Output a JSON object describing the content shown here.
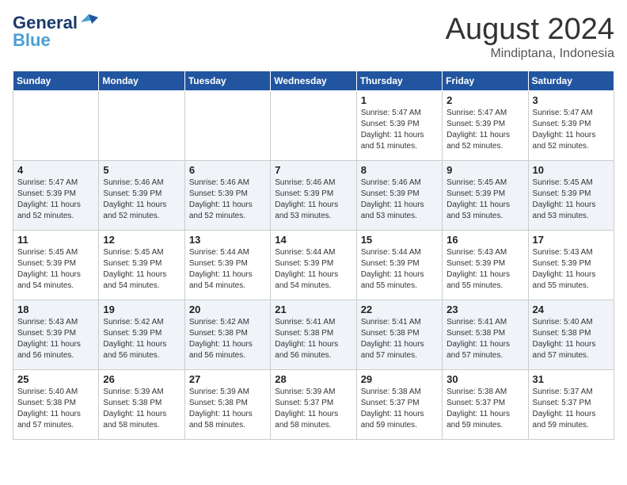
{
  "header": {
    "logo_line1": "General",
    "logo_line2": "Blue",
    "month_year": "August 2024",
    "location": "Mindiptana, Indonesia"
  },
  "days_of_week": [
    "Sunday",
    "Monday",
    "Tuesday",
    "Wednesday",
    "Thursday",
    "Friday",
    "Saturday"
  ],
  "weeks": [
    [
      {
        "day": "",
        "sunrise": "",
        "sunset": "",
        "daylight": ""
      },
      {
        "day": "",
        "sunrise": "",
        "sunset": "",
        "daylight": ""
      },
      {
        "day": "",
        "sunrise": "",
        "sunset": "",
        "daylight": ""
      },
      {
        "day": "",
        "sunrise": "",
        "sunset": "",
        "daylight": ""
      },
      {
        "day": "1",
        "sunrise": "Sunrise: 5:47 AM",
        "sunset": "Sunset: 5:39 PM",
        "daylight": "Daylight: 11 hours and 51 minutes."
      },
      {
        "day": "2",
        "sunrise": "Sunrise: 5:47 AM",
        "sunset": "Sunset: 5:39 PM",
        "daylight": "Daylight: 11 hours and 52 minutes."
      },
      {
        "day": "3",
        "sunrise": "Sunrise: 5:47 AM",
        "sunset": "Sunset: 5:39 PM",
        "daylight": "Daylight: 11 hours and 52 minutes."
      }
    ],
    [
      {
        "day": "4",
        "sunrise": "Sunrise: 5:47 AM",
        "sunset": "Sunset: 5:39 PM",
        "daylight": "Daylight: 11 hours and 52 minutes."
      },
      {
        "day": "5",
        "sunrise": "Sunrise: 5:46 AM",
        "sunset": "Sunset: 5:39 PM",
        "daylight": "Daylight: 11 hours and 52 minutes."
      },
      {
        "day": "6",
        "sunrise": "Sunrise: 5:46 AM",
        "sunset": "Sunset: 5:39 PM",
        "daylight": "Daylight: 11 hours and 52 minutes."
      },
      {
        "day": "7",
        "sunrise": "Sunrise: 5:46 AM",
        "sunset": "Sunset: 5:39 PM",
        "daylight": "Daylight: 11 hours and 53 minutes."
      },
      {
        "day": "8",
        "sunrise": "Sunrise: 5:46 AM",
        "sunset": "Sunset: 5:39 PM",
        "daylight": "Daylight: 11 hours and 53 minutes."
      },
      {
        "day": "9",
        "sunrise": "Sunrise: 5:45 AM",
        "sunset": "Sunset: 5:39 PM",
        "daylight": "Daylight: 11 hours and 53 minutes."
      },
      {
        "day": "10",
        "sunrise": "Sunrise: 5:45 AM",
        "sunset": "Sunset: 5:39 PM",
        "daylight": "Daylight: 11 hours and 53 minutes."
      }
    ],
    [
      {
        "day": "11",
        "sunrise": "Sunrise: 5:45 AM",
        "sunset": "Sunset: 5:39 PM",
        "daylight": "Daylight: 11 hours and 54 minutes."
      },
      {
        "day": "12",
        "sunrise": "Sunrise: 5:45 AM",
        "sunset": "Sunset: 5:39 PM",
        "daylight": "Daylight: 11 hours and 54 minutes."
      },
      {
        "day": "13",
        "sunrise": "Sunrise: 5:44 AM",
        "sunset": "Sunset: 5:39 PM",
        "daylight": "Daylight: 11 hours and 54 minutes."
      },
      {
        "day": "14",
        "sunrise": "Sunrise: 5:44 AM",
        "sunset": "Sunset: 5:39 PM",
        "daylight": "Daylight: 11 hours and 54 minutes."
      },
      {
        "day": "15",
        "sunrise": "Sunrise: 5:44 AM",
        "sunset": "Sunset: 5:39 PM",
        "daylight": "Daylight: 11 hours and 55 minutes."
      },
      {
        "day": "16",
        "sunrise": "Sunrise: 5:43 AM",
        "sunset": "Sunset: 5:39 PM",
        "daylight": "Daylight: 11 hours and 55 minutes."
      },
      {
        "day": "17",
        "sunrise": "Sunrise: 5:43 AM",
        "sunset": "Sunset: 5:39 PM",
        "daylight": "Daylight: 11 hours and 55 minutes."
      }
    ],
    [
      {
        "day": "18",
        "sunrise": "Sunrise: 5:43 AM",
        "sunset": "Sunset: 5:39 PM",
        "daylight": "Daylight: 11 hours and 56 minutes."
      },
      {
        "day": "19",
        "sunrise": "Sunrise: 5:42 AM",
        "sunset": "Sunset: 5:39 PM",
        "daylight": "Daylight: 11 hours and 56 minutes."
      },
      {
        "day": "20",
        "sunrise": "Sunrise: 5:42 AM",
        "sunset": "Sunset: 5:38 PM",
        "daylight": "Daylight: 11 hours and 56 minutes."
      },
      {
        "day": "21",
        "sunrise": "Sunrise: 5:41 AM",
        "sunset": "Sunset: 5:38 PM",
        "daylight": "Daylight: 11 hours and 56 minutes."
      },
      {
        "day": "22",
        "sunrise": "Sunrise: 5:41 AM",
        "sunset": "Sunset: 5:38 PM",
        "daylight": "Daylight: 11 hours and 57 minutes."
      },
      {
        "day": "23",
        "sunrise": "Sunrise: 5:41 AM",
        "sunset": "Sunset: 5:38 PM",
        "daylight": "Daylight: 11 hours and 57 minutes."
      },
      {
        "day": "24",
        "sunrise": "Sunrise: 5:40 AM",
        "sunset": "Sunset: 5:38 PM",
        "daylight": "Daylight: 11 hours and 57 minutes."
      }
    ],
    [
      {
        "day": "25",
        "sunrise": "Sunrise: 5:40 AM",
        "sunset": "Sunset: 5:38 PM",
        "daylight": "Daylight: 11 hours and 57 minutes."
      },
      {
        "day": "26",
        "sunrise": "Sunrise: 5:39 AM",
        "sunset": "Sunset: 5:38 PM",
        "daylight": "Daylight: 11 hours and 58 minutes."
      },
      {
        "day": "27",
        "sunrise": "Sunrise: 5:39 AM",
        "sunset": "Sunset: 5:38 PM",
        "daylight": "Daylight: 11 hours and 58 minutes."
      },
      {
        "day": "28",
        "sunrise": "Sunrise: 5:39 AM",
        "sunset": "Sunset: 5:37 PM",
        "daylight": "Daylight: 11 hours and 58 minutes."
      },
      {
        "day": "29",
        "sunrise": "Sunrise: 5:38 AM",
        "sunset": "Sunset: 5:37 PM",
        "daylight": "Daylight: 11 hours and 59 minutes."
      },
      {
        "day": "30",
        "sunrise": "Sunrise: 5:38 AM",
        "sunset": "Sunset: 5:37 PM",
        "daylight": "Daylight: 11 hours and 59 minutes."
      },
      {
        "day": "31",
        "sunrise": "Sunrise: 5:37 AM",
        "sunset": "Sunset: 5:37 PM",
        "daylight": "Daylight: 11 hours and 59 minutes."
      }
    ]
  ]
}
